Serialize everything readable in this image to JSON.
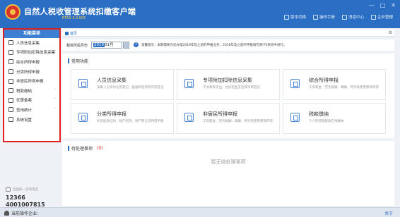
{
  "window": {
    "title": "自然人税收管理系统扣缴客户端",
    "version": "ETAX 3.0.005",
    "controls": [
      "—",
      "□",
      "✕"
    ]
  },
  "top_actions": [
    {
      "label": "版本切换",
      "icon": "switch-icon"
    },
    {
      "label": "操作手册",
      "icon": "manual-icon"
    },
    {
      "label": "消息中心",
      "icon": "message-icon"
    },
    {
      "label": "企业管理",
      "icon": "enterprise-icon"
    }
  ],
  "sidebar": {
    "header": "功能菜单",
    "items": [
      {
        "label": "人员信息采集",
        "icon": "person-icon",
        "has_arrow": false
      },
      {
        "label": "专项附加扣除信息采集",
        "icon": "list-icon",
        "has_arrow": true
      },
      {
        "label": "综合所得申报",
        "icon": "report-icon",
        "has_arrow": false
      },
      {
        "label": "分类所得申报",
        "icon": "clock-icon",
        "has_arrow": false
      },
      {
        "label": "非居民所得申报",
        "icon": "user-icon",
        "has_arrow": false
      },
      {
        "label": "税款缴纳",
        "icon": "tax-icon",
        "has_arrow": true
      },
      {
        "label": "优惠备案",
        "icon": "folder-icon",
        "has_arrow": true
      },
      {
        "label": "查询统计",
        "icon": "search-icon",
        "has_arrow": true
      },
      {
        "label": "系统设置",
        "icon": "gear-icon",
        "has_arrow": false
      }
    ]
  },
  "hotline": {
    "label": "全国统一咨询电话",
    "number1": "12366",
    "number2": "4001007815"
  },
  "tabs": {
    "home": "首页"
  },
  "filter": {
    "label": "税款所属月份",
    "year": "2019",
    "month": "01月",
    "tip": "温馨提示：本期需要为您办理2019年及之前的申报业务，2018年及之前的申报请在原ITS系统中进行。"
  },
  "common": {
    "title": "常用功能",
    "cards": [
      {
        "title": "人员信息采集",
        "desc": "采集人员身份信息登记、报送和反馈等内容登记",
        "icon": "person-card-icon"
      },
      {
        "title": "专项附加扣除信息采集",
        "desc": "子女教育支出、住房租金支出等项目登记",
        "icon": "deduction-icon"
      },
      {
        "title": "综合所得申报",
        "desc": "工资薪金、劳务报酬、稿酬、特许权使用费等所得",
        "icon": "comprehensive-icon"
      },
      {
        "title": "分类所得申报",
        "desc": "利息股息红利、财产租赁、财产转让等所得申报",
        "icon": "classified-icon"
      },
      {
        "title": "非居民所得申报",
        "desc": "工资薪金、劳务报酬、稿酬、特许权使用费等所得",
        "icon": "nonresident-icon"
      },
      {
        "title": "税款缴纳",
        "desc": "个人所得税税款在线缴纳",
        "icon": "payment-icon"
      }
    ]
  },
  "pending": {
    "title": "待处理事项",
    "count": "(0)",
    "empty": "暂无待处理事项"
  },
  "status": {
    "operator_label": "当前操作企业:",
    "right": "关于"
  }
}
